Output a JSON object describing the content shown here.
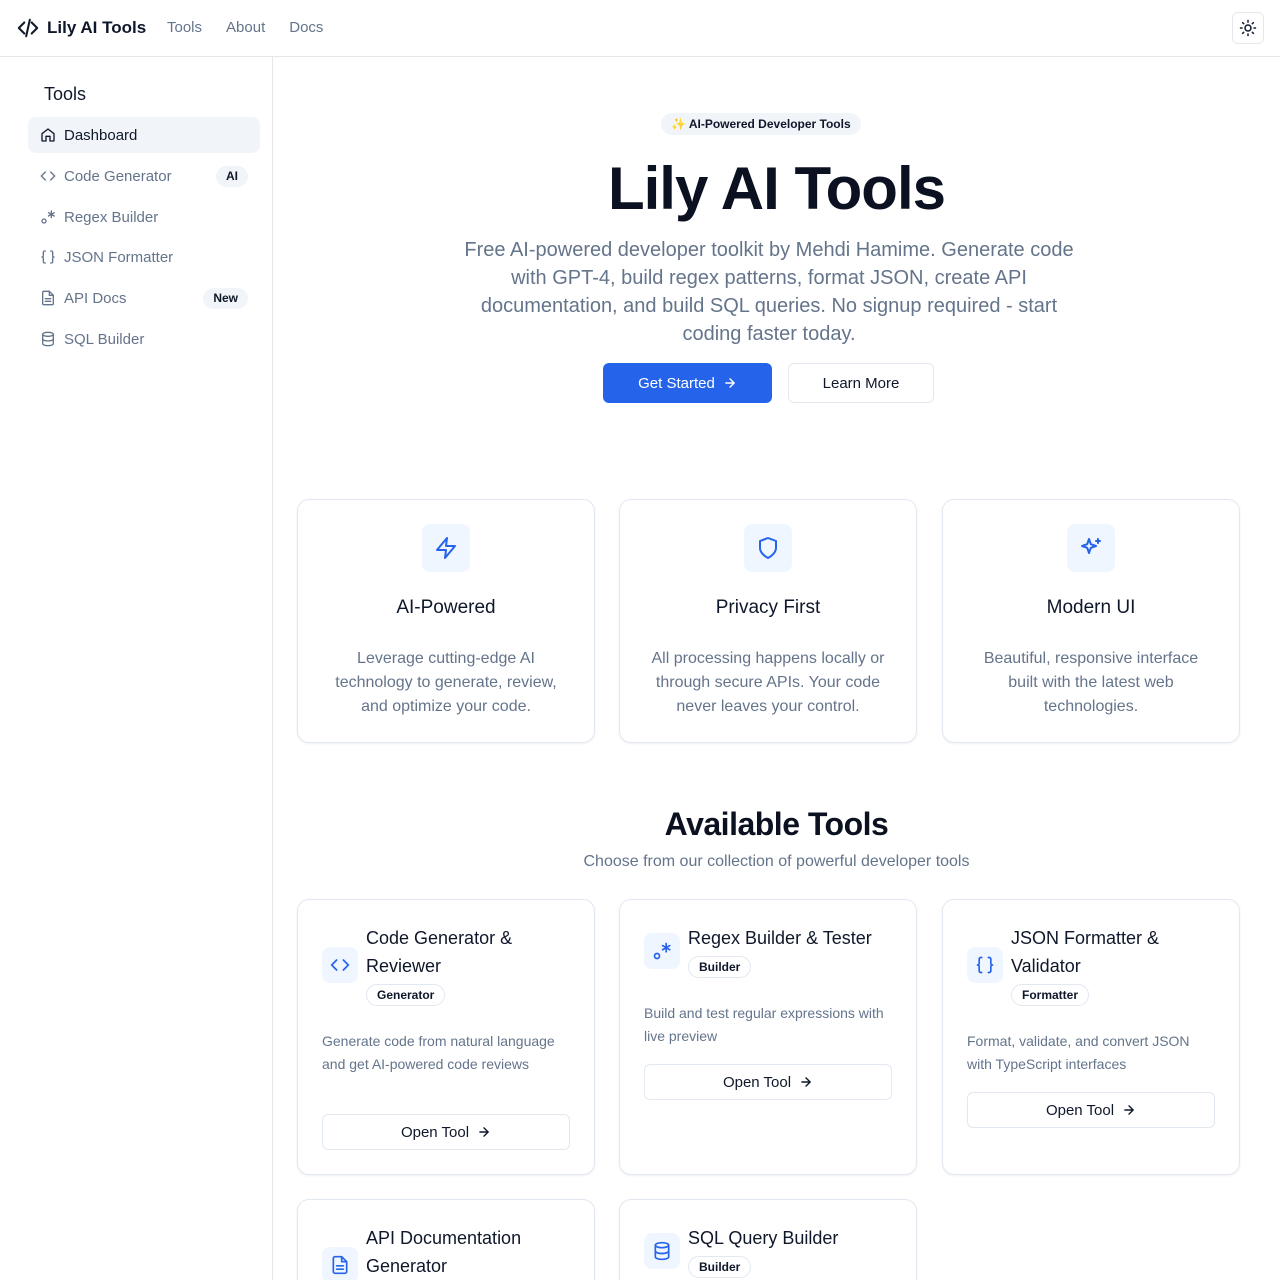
{
  "nav": {
    "brand": "Lily AI Tools",
    "links": [
      "Tools",
      "About",
      "Docs"
    ],
    "theme_icon": "sun-icon"
  },
  "sidebar": {
    "title": "Tools",
    "items": [
      {
        "label": "Dashboard",
        "icon": "home-icon",
        "active": true
      },
      {
        "label": "Code Generator",
        "icon": "code-icon",
        "badge": "AI"
      },
      {
        "label": "Regex Builder",
        "icon": "regex-icon"
      },
      {
        "label": "JSON Formatter",
        "icon": "braces-icon"
      },
      {
        "label": "API Docs",
        "icon": "file-text-icon",
        "badge": "New"
      },
      {
        "label": "SQL Builder",
        "icon": "database-icon"
      }
    ]
  },
  "hero": {
    "pill": "✨ AI-Powered Developer Tools",
    "title": "Lily AI Tools",
    "description": "Free AI-powered developer toolkit by Mehdi Hamime. Generate code with GPT-4, build regex patterns, format JSON, create API documentation, and build SQL queries. No signup required - start coding faster today.",
    "primary_button": "Get Started",
    "secondary_button": "Learn More"
  },
  "features": [
    {
      "title": "AI-Powered",
      "icon": "zap-icon",
      "description": "Leverage cutting-edge AI technology to generate, review, and optimize your code."
    },
    {
      "title": "Privacy First",
      "icon": "shield-icon",
      "description": "All processing happens locally or through secure APIs. Your code never leaves your control."
    },
    {
      "title": "Modern UI",
      "icon": "sparkles-icon",
      "description": "Beautiful, responsive interface built with the latest web technologies."
    }
  ],
  "tools_section": {
    "title": "Available Tools",
    "subtitle": "Choose from our collection of powerful developer tools",
    "open_label": "Open Tool",
    "tools": [
      {
        "title": "Code Generator & Reviewer",
        "badge": "Generator",
        "icon": "code-icon",
        "description": "Generate code from natural language and get AI-powered code reviews"
      },
      {
        "title": "Regex Builder & Tester",
        "badge": "Builder",
        "icon": "regex-icon",
        "description": "Build and test regular expressions with live preview"
      },
      {
        "title": "JSON Formatter & Validator",
        "badge": "Formatter",
        "icon": "braces-icon",
        "description": "Format, validate, and convert JSON with TypeScript interfaces"
      },
      {
        "title": "API Documentation Generator",
        "icon": "file-text-icon"
      },
      {
        "title": "SQL Query Builder",
        "badge": "Builder",
        "icon": "database-icon"
      }
    ]
  },
  "colors": {
    "accent": "#2563eb",
    "icon_bg": "#eff6ff",
    "muted_text": "#64748b",
    "border": "#e2e8f0"
  }
}
